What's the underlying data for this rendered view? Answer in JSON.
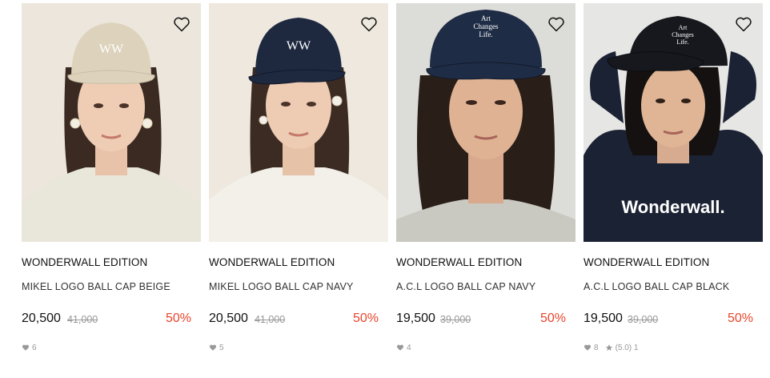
{
  "colors": {
    "discount": "#e8452c",
    "original_price": "#999999",
    "text": "#111111",
    "meta": "#999999"
  },
  "icons": {
    "wishlist": "heart-outline-icon",
    "likes": "heart-filled-icon",
    "rating": "star-icon"
  },
  "products": [
    {
      "brand": "WONDERWALL EDITION",
      "name": "MIKEL LOGO BALL CAP BEIGE",
      "price": "20,500",
      "original_price": "41,000",
      "discount": "50%",
      "likes": "6",
      "cap_logo": "WW",
      "bg": "#ece6dc",
      "cap_color": "#ddd3bd",
      "shirt_color": "#e9e7da"
    },
    {
      "brand": "WONDERWALL EDITION",
      "name": "MIKEL LOGO BALL CAP NAVY",
      "price": "20,500",
      "original_price": "41,000",
      "discount": "50%",
      "likes": "5",
      "cap_logo": "WW",
      "bg": "#eee8de",
      "cap_color": "#1e2940",
      "shirt_color": "#f2f0e8"
    },
    {
      "brand": "WONDERWALL EDITION",
      "name": "A.C.L LOGO BALL CAP NAVY",
      "price": "19,500",
      "original_price": "39,000",
      "discount": "50%",
      "likes": "4",
      "cap_logo": "Art Changes Life.",
      "bg": "#dcdcd8",
      "cap_color": "#1f2c45",
      "shirt_color": "#c9c9c1"
    },
    {
      "brand": "WONDERWALL EDITION",
      "name": "A.C.L LOGO BALL CAP BLACK",
      "price": "19,500",
      "original_price": "39,000",
      "discount": "50%",
      "likes": "8",
      "rating": "(5.0) 1",
      "cap_logo": "Art Changes Life.",
      "hoodie_text": "Wonderwall.",
      "bg": "#e6e6e4",
      "cap_color": "#16181d",
      "shirt_color": "#1b2233"
    }
  ]
}
